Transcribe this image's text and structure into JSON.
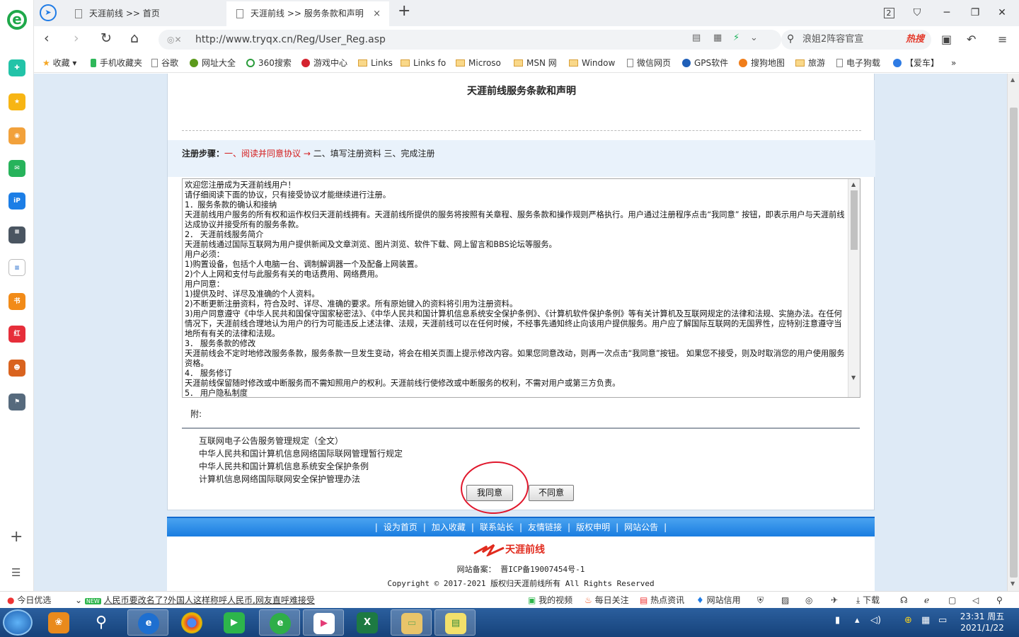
{
  "tabs": [
    {
      "label": "天涯前线 >> 首页"
    },
    {
      "label": "天涯前线 >> 服务条款和声明",
      "close": "×"
    }
  ],
  "window_controls": {
    "count": "2",
    "min": "─",
    "max": "❐",
    "close": "✕"
  },
  "address": {
    "url": "http://www.tryqx.cn/Reg/User_Reg.asp",
    "search_text": "浪姐2阵容官宣",
    "search_badge": "热搜"
  },
  "bookmarks": [
    "收藏",
    "手机收藏夹",
    "谷歌",
    "网址大全",
    "360搜索",
    "游戏中心",
    "Links",
    "Links fo",
    "Microso",
    "MSN 网",
    "Window",
    "微信网页",
    "GPS软件",
    "搜狗地图",
    "旅游",
    "电子狗载",
    "【爱车】"
  ],
  "page": {
    "title": "天涯前线服务条款和声明",
    "steps_label": "注册步骤：",
    "step1": "一、阅读并同意协议 →",
    "step2": " 二、填写注册资料",
    "step3": " 三、完成注册",
    "agreement": "欢迎您注册成为天涯前线用户！\n请仔细阅读下面的协议，只有接受协议才能继续进行注册。\n1．服务条款的确认和接纳\n天涯前线用户服务的所有权和运作权归天涯前线拥有。天涯前线所提供的服务将按照有关章程、服务条款和操作规则严格执行。用户通过注册程序点击“我同意” 按钮，即表示用户与天涯前线达成协议并接受所有的服务条款。\n2． 天涯前线服务简介\n天涯前线通过国际互联网为用户提供新闻及文章浏览、图片浏览、软件下载、网上留言和BBS论坛等服务。\n用户必须：\n1)购置设备，包括个人电脑一台、调制解调器一个及配备上网装置。\n2)个人上网和支付与此服务有关的电话费用、网络费用。\n用户同意：\n1)提供及时、详尽及准确的个人资料。\n2)不断更新注册资料，符合及时、详尽、准确的要求。所有原始键入的资料将引用为注册资料。\n3)用户同意遵守《中华人民共和国保守国家秘密法》、《中华人民共和国计算机信息系统安全保护条例》、《计算机软件保护条例》等有关计算机及互联网规定的法律和法规、实施办法。在任何情况下，天涯前线合理地认为用户的行为可能违反上述法律、法规，天涯前线可以在任何时候，不经事先通知终止向该用户提供服务。用户应了解国际互联网的无国界性，应特别注意遵守当地所有有关的法律和法规。\n3． 服务条款的修改\n天涯前线会不定时地修改服务条款，服务条款一旦发生变动，将会在相关页面上提示修改内容。如果您同意改动，则再一次点击“我同意”按钮。 如果您不接受，则及时取消您的用户使用服务资格。\n4． 服务修订\n天涯前线保留随时修改或中断服务而不需知照用户的权利。天涯前线行使修改或中断服务的权利，不需对用户或第三方负责。\n5． 用户隐私制度",
    "attach_label": "附:",
    "links": [
      "互联网电子公告服务管理规定（全文）",
      "中华人民共和国计算机信息网络国际联网管理暂行规定",
      "中华人民共和国计算机信息系统安全保护条例",
      "计算机信息网络国际联网安全保护管理办法"
    ],
    "agree_button": "我同意",
    "disagree_button": "不同意",
    "footer_links": [
      "设为首页",
      "加入收藏",
      "联系站长",
      "友情链接",
      "版权申明",
      "网站公告"
    ],
    "footer_sep": "|",
    "footer_logo": "天涯前线",
    "icp": "网站备案： 晋ICP备19007454号-1",
    "copyright": "Copyright © 2017-2021 版权归天涯前线所有 All Rights Reserved"
  },
  "status_bar": {
    "today": "今日优选",
    "new_badge": "NEW",
    "news": "人民币要改名了?外国人这样称呼人民币,网友直呼难接受",
    "video": "我的视频",
    "daily": "每日关注",
    "hot": "热点资讯",
    "credit": "网站信用",
    "download": "下载"
  },
  "clock": {
    "time": "23:31 周五",
    "date": "2021/1/22"
  },
  "colors": {
    "accent": "#1a7de0",
    "step_red": "#d41b1b",
    "highlight_circle": "#e0172c"
  }
}
